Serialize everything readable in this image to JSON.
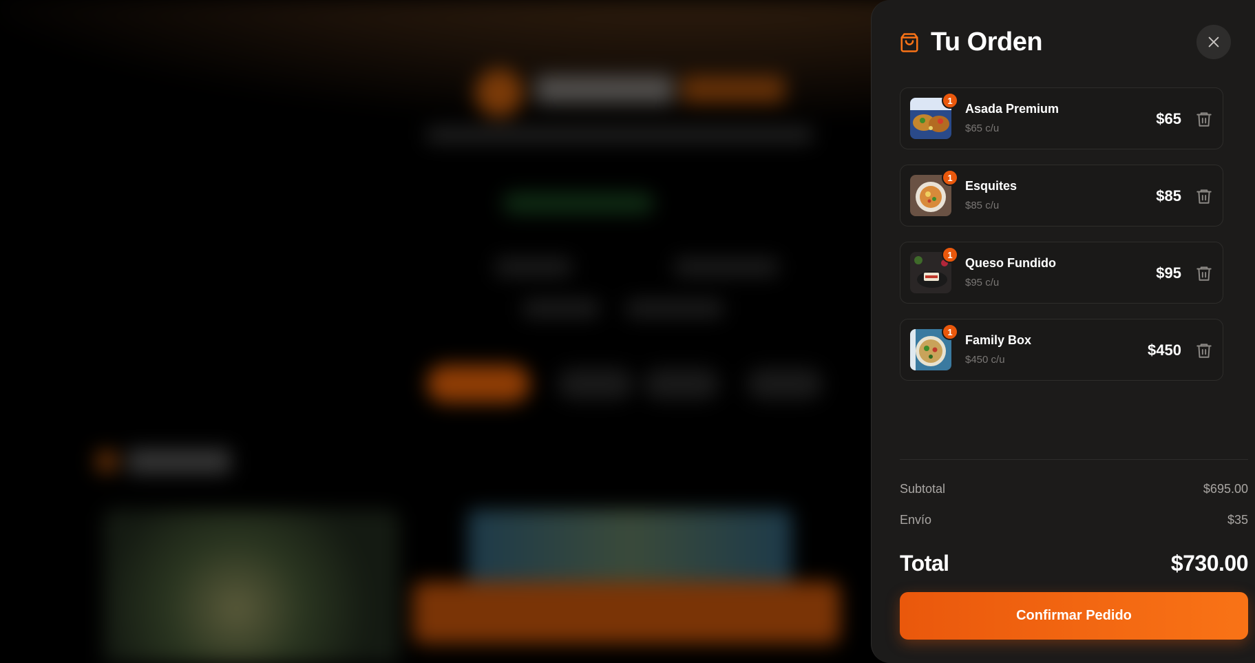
{
  "cart": {
    "title": "Tu Orden",
    "items": [
      {
        "name": "Asada Premium",
        "unit": "$65 c/u",
        "price": "$65",
        "qty": "1"
      },
      {
        "name": "Esquites",
        "unit": "$85 c/u",
        "price": "$85",
        "qty": "1"
      },
      {
        "name": "Queso Fundido",
        "unit": "$95 c/u",
        "price": "$95",
        "qty": "1"
      },
      {
        "name": "Family Box",
        "unit": "$450 c/u",
        "price": "$450",
        "qty": "1"
      }
    ],
    "summary": {
      "subtotal_label": "Subtotal",
      "subtotal_value": "$695.00",
      "shipping_label": "Envío",
      "shipping_value": "$35",
      "total_label": "Total",
      "total_value": "$730.00"
    },
    "confirm_label": "Confirmar Pedido"
  },
  "colors": {
    "accent": "#ea580c",
    "drawer_bg": "#1c1b1a"
  },
  "icons": [
    "shopping-bag-icon",
    "close-icon",
    "trash-icon"
  ]
}
